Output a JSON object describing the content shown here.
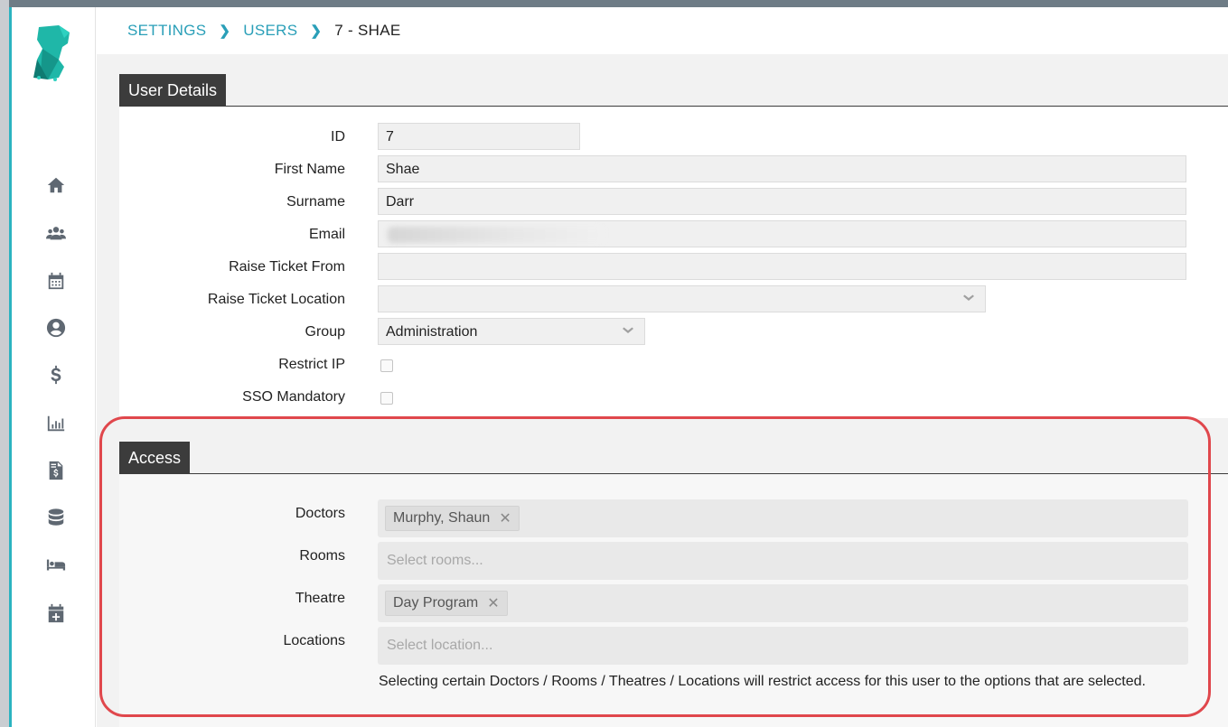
{
  "breadcrumb": {
    "items": [
      "SETTINGS",
      "USERS"
    ],
    "current": "7 - SHAE"
  },
  "sidebar": {
    "icons": [
      "home-icon",
      "users-icon",
      "calendar-icon",
      "user-circle-icon",
      "dollar-icon",
      "bar-chart-icon",
      "invoice-icon",
      "database-icon",
      "bed-icon",
      "calendar-plus-icon"
    ]
  },
  "user_details": {
    "title": "User Details",
    "fields": {
      "id": {
        "label": "ID",
        "value": "7"
      },
      "first_name": {
        "label": "First Name",
        "value": "Shae"
      },
      "surname": {
        "label": "Surname",
        "value": "Darr"
      },
      "email": {
        "label": "Email",
        "value": ""
      },
      "raise_ticket_from": {
        "label": "Raise Ticket From",
        "value": ""
      },
      "raise_ticket_location": {
        "label": "Raise Ticket Location",
        "value": ""
      },
      "group": {
        "label": "Group",
        "value": "Administration"
      },
      "restrict_ip": {
        "label": "Restrict IP",
        "checked": false
      },
      "sso_mandatory": {
        "label": "SSO Mandatory",
        "checked": false
      }
    }
  },
  "access": {
    "title": "Access",
    "doctors": {
      "label": "Doctors",
      "tags": [
        "Murphy, Shaun"
      ]
    },
    "rooms": {
      "label": "Rooms",
      "placeholder": "Select rooms..."
    },
    "theatre": {
      "label": "Theatre",
      "tags": [
        "Day Program"
      ]
    },
    "locations": {
      "label": "Locations",
      "placeholder": "Select location..."
    },
    "help_text": "Selecting certain Doctors / Rooms / Theatres / Locations will restrict access for this user to the options that are selected."
  },
  "colors": {
    "accent": "#2a9fb8",
    "header_tab": "#3c3c3c",
    "highlight": "#e0474c"
  }
}
